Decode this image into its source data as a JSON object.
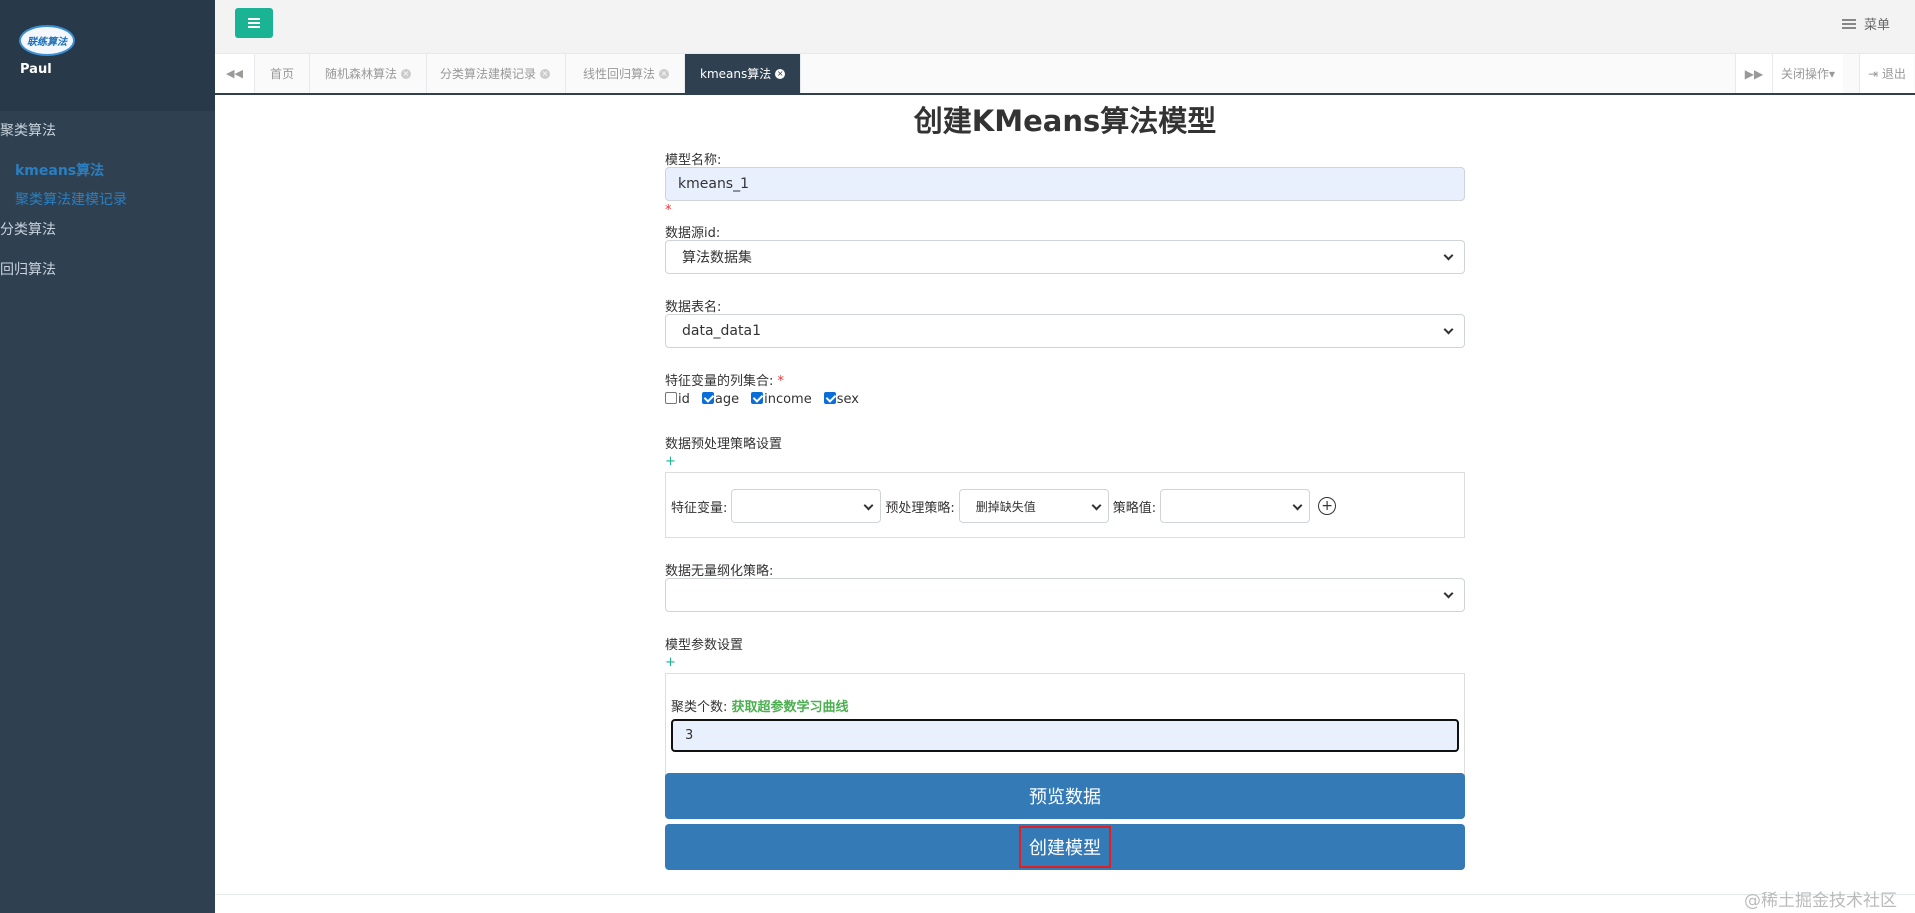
{
  "sidebar": {
    "logo_text": "联练算法",
    "user": "Paul",
    "groups": [
      {
        "label": "聚类算法"
      },
      {
        "label": "分类算法"
      },
      {
        "label": "回归算法"
      }
    ],
    "sub_items": [
      {
        "label": "kmeans算法"
      },
      {
        "label": "聚类算法建模记录"
      }
    ]
  },
  "topbar": {
    "menu_label": "菜单"
  },
  "tabs": {
    "items": [
      {
        "label": "首页"
      },
      {
        "label": "随机森林算法"
      },
      {
        "label": "分类算法建模记录"
      },
      {
        "label": "线性回归算法"
      },
      {
        "label": "kmeans算法"
      }
    ],
    "close_ops": "关闭操作",
    "logout": "退出"
  },
  "form": {
    "title": "创建KMeans算法模型",
    "model_name_label": "模型名称:",
    "model_name_value": "kmeans_1",
    "required_mark": "*",
    "datasource_label": "数据源id:",
    "datasource_value": "算法数据集",
    "table_label": "数据表名:",
    "table_value": "data_data1",
    "features_label": "特征变量的列集合:",
    "features": [
      {
        "label": "id",
        "checked": false
      },
      {
        "label": "age",
        "checked": true
      },
      {
        "label": "income",
        "checked": true
      },
      {
        "label": "sex",
        "checked": true
      }
    ],
    "preprocess_label": "数据预处理策略设置",
    "plus": "+",
    "feature_var_label": "特征变量:",
    "preprocess_strategy_label": "预处理策略:",
    "preprocess_strategy_value": "删掉缺失值",
    "strategy_value_label": "策略值:",
    "add_symbol": "+",
    "scaling_label": "数据无量纲化策略:",
    "params_label": "模型参数设置",
    "k_label": "聚类个数:",
    "k_link": "获取超参数学习曲线",
    "k_value": "3",
    "preview_button": "预览数据",
    "create_button": "创建模型"
  },
  "watermark": "@稀土掘金技术社区"
}
